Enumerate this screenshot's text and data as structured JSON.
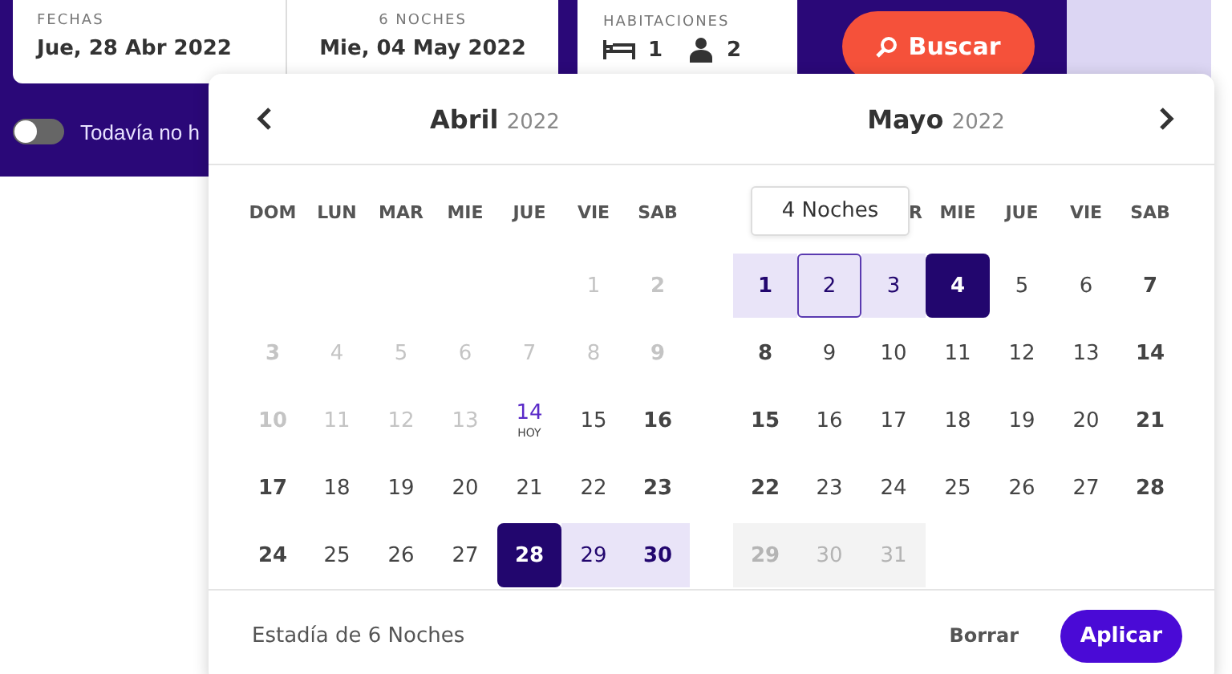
{
  "search_bar": {
    "dates": [
      {
        "label": "FECHAS",
        "value": "Jue, 28 Abr 2022"
      },
      {
        "label": "6 NOCHES",
        "value": "Mie, 04 May 2022"
      }
    ],
    "rooms": {
      "label": "HABITACIONES",
      "rooms": "1",
      "guests": "2"
    },
    "search_button": "Buscar",
    "toggle": {
      "label": "Todavía no h",
      "on": false
    }
  },
  "calendar": {
    "months": [
      {
        "name": "Abril",
        "year": "2022",
        "weekdays": [
          "DOM",
          "LUN",
          "MAR",
          "MIE",
          "JUE",
          "VIE",
          "SAB"
        ],
        "days": [
          {
            "kind": "blank"
          },
          {
            "kind": "blank"
          },
          {
            "kind": "blank"
          },
          {
            "kind": "blank"
          },
          {
            "kind": "blank"
          },
          {
            "day": "1",
            "kind": "past"
          },
          {
            "day": "2",
            "kind": "past"
          },
          {
            "day": "3",
            "kind": "past"
          },
          {
            "day": "4",
            "kind": "past"
          },
          {
            "day": "5",
            "kind": "past"
          },
          {
            "day": "6",
            "kind": "past"
          },
          {
            "day": "7",
            "kind": "past"
          },
          {
            "day": "8",
            "kind": "past"
          },
          {
            "day": "9",
            "kind": "past"
          },
          {
            "day": "10",
            "kind": "past"
          },
          {
            "day": "11",
            "kind": "past"
          },
          {
            "day": "12",
            "kind": "past"
          },
          {
            "day": "13",
            "kind": "past"
          },
          {
            "day": "14",
            "kind": "today",
            "note": "HOY"
          },
          {
            "day": "15",
            "kind": "normal"
          },
          {
            "day": "16",
            "kind": "normal"
          },
          {
            "day": "17",
            "kind": "normal"
          },
          {
            "day": "18",
            "kind": "normal"
          },
          {
            "day": "19",
            "kind": "normal"
          },
          {
            "day": "20",
            "kind": "normal"
          },
          {
            "day": "21",
            "kind": "normal"
          },
          {
            "day": "22",
            "kind": "normal"
          },
          {
            "day": "23",
            "kind": "normal"
          },
          {
            "day": "24",
            "kind": "normal"
          },
          {
            "day": "25",
            "kind": "normal"
          },
          {
            "day": "26",
            "kind": "normal"
          },
          {
            "day": "27",
            "kind": "normal"
          },
          {
            "day": "28",
            "kind": "start"
          },
          {
            "day": "29",
            "kind": "range"
          },
          {
            "day": "30",
            "kind": "range"
          }
        ]
      },
      {
        "name": "Mayo",
        "year": "2022",
        "weekdays": [
          "R",
          "MIE",
          "JUE",
          "VIE",
          "SAB"
        ],
        "days": [
          {
            "day": "1",
            "kind": "range"
          },
          {
            "day": "2",
            "kind": "hover"
          },
          {
            "day": "3",
            "kind": "range"
          },
          {
            "day": "4",
            "kind": "end"
          },
          {
            "day": "5",
            "kind": "normal"
          },
          {
            "day": "6",
            "kind": "normal"
          },
          {
            "day": "7",
            "kind": "normal"
          },
          {
            "day": "8",
            "kind": "normal"
          },
          {
            "day": "9",
            "kind": "normal"
          },
          {
            "day": "10",
            "kind": "normal"
          },
          {
            "day": "11",
            "kind": "normal"
          },
          {
            "day": "12",
            "kind": "normal"
          },
          {
            "day": "13",
            "kind": "normal"
          },
          {
            "day": "14",
            "kind": "normal"
          },
          {
            "day": "15",
            "kind": "normal"
          },
          {
            "day": "16",
            "kind": "normal"
          },
          {
            "day": "17",
            "kind": "normal"
          },
          {
            "day": "18",
            "kind": "normal"
          },
          {
            "day": "19",
            "kind": "normal"
          },
          {
            "day": "20",
            "kind": "normal"
          },
          {
            "day": "21",
            "kind": "normal"
          },
          {
            "day": "22",
            "kind": "normal"
          },
          {
            "day": "23",
            "kind": "normal"
          },
          {
            "day": "24",
            "kind": "normal"
          },
          {
            "day": "25",
            "kind": "normal"
          },
          {
            "day": "26",
            "kind": "normal"
          },
          {
            "day": "27",
            "kind": "normal"
          },
          {
            "day": "28",
            "kind": "normal"
          },
          {
            "day": "29",
            "kind": "blocked"
          },
          {
            "day": "30",
            "kind": "blocked"
          },
          {
            "day": "31",
            "kind": "blocked"
          }
        ]
      }
    ],
    "tooltip": "4 Noches",
    "summary": "Estadía de 6 Noches",
    "clear_button": "Borrar",
    "apply_button": "Aplicar"
  }
}
